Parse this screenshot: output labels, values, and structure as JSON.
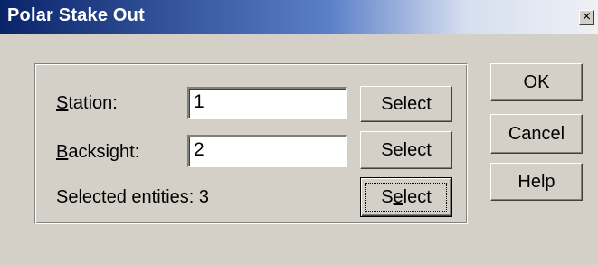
{
  "window": {
    "title": "Polar Stake Out",
    "close_glyph": "×"
  },
  "form": {
    "station": {
      "label_accel": "S",
      "label_rest": "tation:",
      "value": "1",
      "select_label": "Select"
    },
    "backsight": {
      "label_accel": "B",
      "label_rest": "acksight:",
      "value": "2",
      "select_label": "Select"
    },
    "entities": {
      "label": "Selected entities: 3",
      "select_pre": "S",
      "select_accel": "e",
      "select_post": "lect"
    }
  },
  "buttons": {
    "ok": "OK",
    "cancel": "Cancel",
    "help": "Help"
  },
  "colors": {
    "title_start": "#0a246a",
    "title_end": "#eef0f4",
    "face": "#d4d0c8"
  }
}
